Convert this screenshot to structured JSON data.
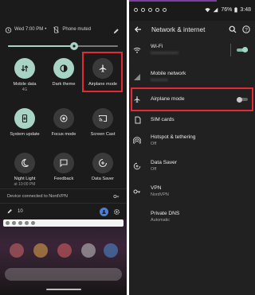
{
  "left": {
    "status": {
      "time": "Wed 7:00 PM",
      "separator": "•",
      "muted_text": "Phone muted"
    },
    "brightness_level": 0.6,
    "tiles": [
      {
        "label": "Mobile data",
        "sub": "4G",
        "icon": "mobile-data-icon",
        "on": true
      },
      {
        "label": "Dark theme",
        "sub": "",
        "icon": "dark-theme-icon",
        "on": true
      },
      {
        "label": "Airplane mode",
        "sub": "",
        "icon": "airplane-icon",
        "on": false
      },
      {
        "label": "System update",
        "sub": "",
        "icon": "system-update-icon",
        "on": true
      },
      {
        "label": "Focus mode",
        "sub": "",
        "icon": "focus-mode-icon",
        "on": false
      },
      {
        "label": "Screen Cast",
        "sub": "",
        "icon": "screen-cast-icon",
        "on": false
      },
      {
        "label": "Night Light",
        "sub": "at 10:00 PM",
        "icon": "night-light-icon",
        "on": false
      },
      {
        "label": "Feedback",
        "sub": "",
        "icon": "feedback-icon",
        "on": false
      },
      {
        "label": "Data Saver",
        "sub": "",
        "icon": "data-saver-icon",
        "on": false
      }
    ],
    "vpn_text": "Device connected to NordVPN",
    "build_text": "10"
  },
  "right": {
    "status_time": "3:48",
    "battery": "76%",
    "title": "Network & internet",
    "rows": [
      {
        "title": "Wi-Fi",
        "sub": "",
        "icon": "wifi-icon",
        "toggle": "on"
      },
      {
        "title": "Mobile network",
        "sub": "",
        "icon": "mobile-network-icon",
        "toggle": null
      },
      {
        "title": "Airplane mode",
        "sub": "",
        "icon": "airplane-icon",
        "toggle": "off"
      },
      {
        "title": "SIM cards",
        "sub": "",
        "icon": "sim-card-icon",
        "toggle": null
      },
      {
        "title": "Hotspot & tethering",
        "sub": "Off",
        "icon": "hotspot-icon",
        "toggle": null
      },
      {
        "title": "Data Saver",
        "sub": "Off",
        "icon": "data-saver-icon",
        "toggle": null
      },
      {
        "title": "VPN",
        "sub": "NordVPN",
        "icon": "vpn-key-icon",
        "toggle": null
      },
      {
        "title": "Private DNS",
        "sub": "Automatic",
        "icon": "",
        "toggle": null
      }
    ]
  },
  "colors": {
    "accent": "#a9d3c4",
    "highlight": "#e52a36",
    "panel_bg": "#1b1b1b",
    "settings_bg": "#212121"
  }
}
